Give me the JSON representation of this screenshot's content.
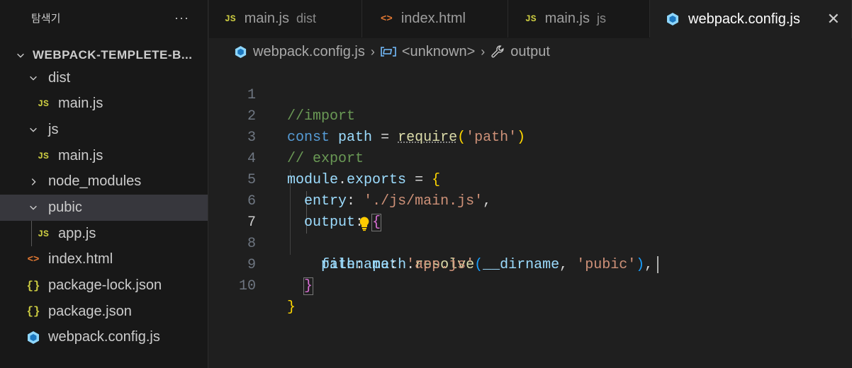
{
  "sidebar": {
    "title": "탐색기",
    "more": "···",
    "root_label": "WEBPACK-TEMPLETE-B...",
    "items": [
      {
        "label": "dist"
      },
      {
        "label": "main.js"
      },
      {
        "label": "js"
      },
      {
        "label": "main.js"
      },
      {
        "label": "node_modules"
      },
      {
        "label": "pubic"
      },
      {
        "label": "app.js"
      },
      {
        "label": "index.html"
      },
      {
        "label": "package-lock.json"
      },
      {
        "label": "package.json"
      },
      {
        "label": "webpack.config.js"
      }
    ]
  },
  "icons": {
    "js": "JS",
    "html": "<>",
    "json": "{}"
  },
  "tabs": [
    {
      "label": "main.js",
      "desc": "dist"
    },
    {
      "label": "index.html",
      "desc": ""
    },
    {
      "label": "main.js",
      "desc": "js"
    },
    {
      "label": "webpack.config.js",
      "desc": "",
      "close": "✕"
    }
  ],
  "breadcrumb": {
    "file": "webpack.config.js",
    "symbol": "<unknown>",
    "prop": "output"
  },
  "editor": {
    "line_numbers": [
      "1",
      "2",
      "3",
      "4",
      "5",
      "6",
      "7",
      "8",
      "9",
      "10"
    ],
    "active_line": "7"
  },
  "colors": {
    "accent": "#cbcb41",
    "keyword": "#569cd6",
    "string": "#ce9178",
    "comment": "#6a9955"
  }
}
